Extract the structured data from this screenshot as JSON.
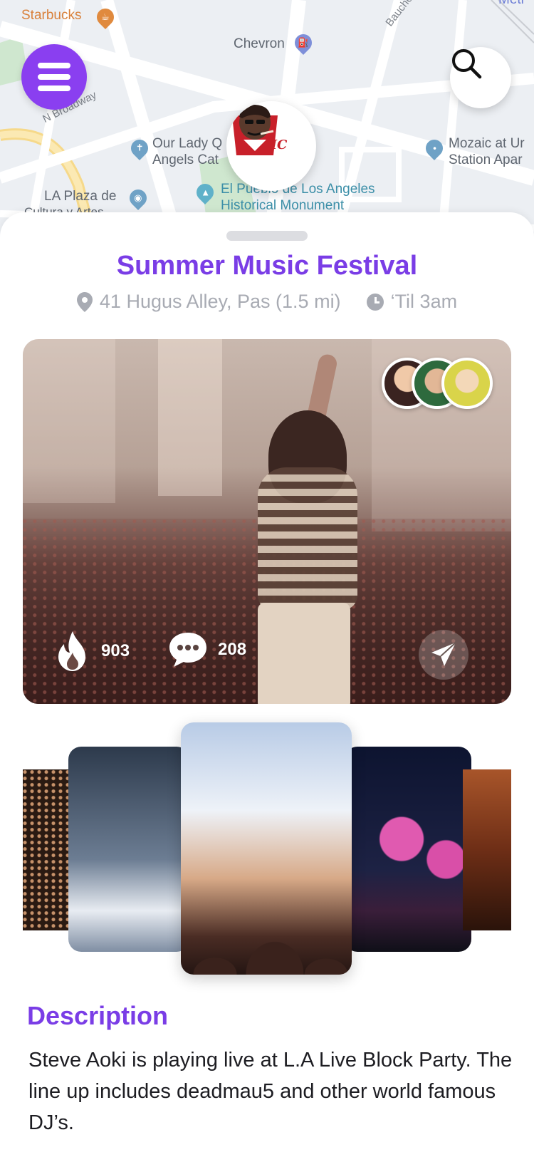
{
  "map": {
    "labels": {
      "starbucks": "Starbucks",
      "chevron": "Chevron",
      "bauchet": "Bauchet St",
      "broadway": "N Broadway",
      "our_lady_1": "Our Lady Q",
      "our_lady_2": "Angels Cat",
      "mozaic_1": "Mozaic at Ur",
      "mozaic_2": "Station Apar",
      "la_plaza_1": "LA Plaza de",
      "la_plaza_2": "Cultura y Artes",
      "pueblo_1": "El Pueblo de Los Angeles",
      "pueblo_2": "Historical Monument",
      "metro": "Metr"
    },
    "logo_text": "THC"
  },
  "event": {
    "title": "Summer Music Festival",
    "address": "41 Hugus Alley, Pas (1.5 mi)",
    "hours": "‘Til 3am",
    "likes": "903",
    "comments": "208"
  },
  "description": {
    "heading": "Description",
    "body": "Steve Aoki is playing live at L.A Live Block Party.  The line up includes deadmau5 and other world famous DJ’s."
  },
  "colors": {
    "accent": "#7a3de6",
    "menu_button": "#8a3ff0",
    "muted_text": "#a8abb3"
  },
  "icons": {
    "menu": "hamburger-icon",
    "search": "search-icon",
    "location": "map-pin-icon",
    "time": "clock-icon",
    "likes": "fire-icon",
    "comments": "chat-bubble-icon",
    "share": "paper-plane-icon"
  }
}
